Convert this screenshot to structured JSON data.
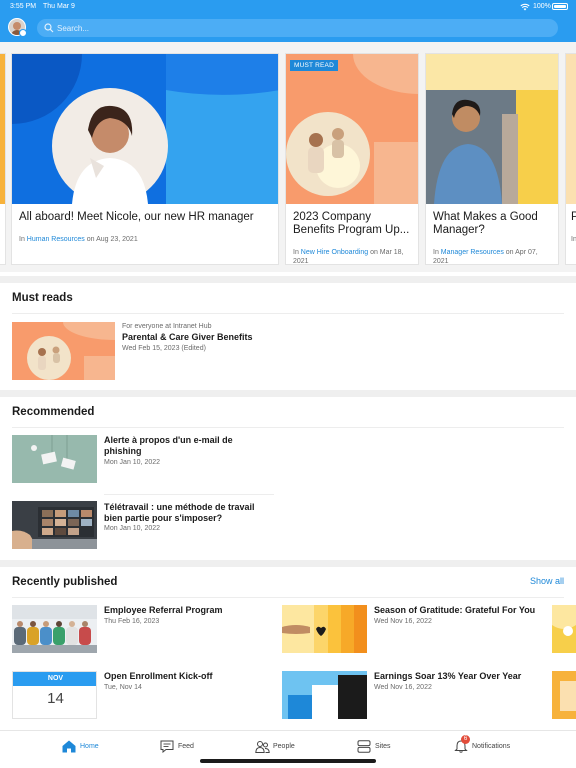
{
  "status_bar": {
    "time": "3:55 PM",
    "date": "Thu Mar 9",
    "battery": "100%"
  },
  "search": {
    "placeholder": "Search..."
  },
  "featured": [
    {
      "title": "All aboard! Meet Nicole, our new HR manager",
      "prefix": "In",
      "site": "Human Resources",
      "date_text": "on Aug 23, 2021"
    },
    {
      "badge": "MUST READ",
      "title": "2023 Company Benefits Program Up...",
      "prefix": "In",
      "site": "New Hire Onboarding",
      "date_text": "on Mar 18, 2021"
    },
    {
      "title": "What Makes a Good Manager?",
      "prefix": "In",
      "site": "Manager Resources",
      "date_text": "on Apr 07, 2021"
    },
    {
      "title": "P",
      "prefix": "In",
      "site": "",
      "date_text": ""
    }
  ],
  "must_reads": {
    "title": "Must reads",
    "items": [
      {
        "audience": "For everyone at Intranet Hub",
        "title": "Parental & Care Giver Benefits",
        "date": "Wed Feb 15, 2023 (Edited)"
      }
    ]
  },
  "recommended": {
    "title": "Recommended",
    "items": [
      {
        "title": "Alerte à propos d'un e-mail de phishing",
        "date": "Mon Jan 10, 2022"
      },
      {
        "title": "Télétravail : une méthode de travail bien partie pour s'imposer?",
        "date": "Mon Jan 10, 2022"
      }
    ]
  },
  "recently_published": {
    "title": "Recently published",
    "show_all": "Show all",
    "items": [
      {
        "title": "Employee Referral Program",
        "date": "Thu Feb 16, 2023"
      },
      {
        "title": "Season of Gratitude: Grateful For You",
        "date": "Wed Nov 16, 2022"
      },
      {
        "title": "Open Enrollment Kick-off",
        "date": "Tue, Nov 14",
        "cal_month": "NOV",
        "cal_day": "14"
      },
      {
        "title": "Earnings Soar 13% Year Over Year",
        "date": "Wed Nov 16, 2022"
      }
    ]
  },
  "tabs": [
    {
      "label": "Home",
      "icon": "home-icon",
      "active": true
    },
    {
      "label": "Feed",
      "icon": "feed-icon"
    },
    {
      "label": "People",
      "icon": "people-icon"
    },
    {
      "label": "Sites",
      "icon": "sites-icon"
    },
    {
      "label": "Notifications",
      "icon": "bell-icon",
      "count": "6"
    }
  ],
  "colors": {
    "brand": "#2a9cf0",
    "link": "#1e88d8",
    "orange": "#f89b6c",
    "yellow": "#f7cf4a",
    "blue": "#0f6fe0",
    "sky": "#34a3ef"
  }
}
